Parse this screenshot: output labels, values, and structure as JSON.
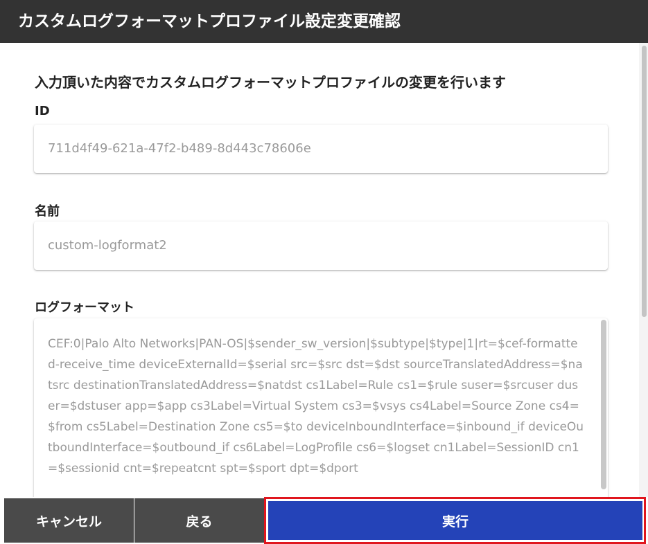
{
  "dialog": {
    "title": "カスタムログフォーマットプロファイル設定変更確認",
    "lead": "入力頂いた内容でカスタムログフォーマットプロファイルの変更を行います"
  },
  "fields": {
    "id": {
      "label": "ID",
      "value": "711d4f49-621a-47f2-b489-8d443c78606e"
    },
    "name": {
      "label": "名前",
      "value": "custom-logformat2"
    },
    "log_format": {
      "label": "ログフォーマット",
      "value": "CEF:0|Palo Alto Networks|PAN-OS|$sender_sw_version|$subtype|$type|1|rt=$cef-formatted-receive_time deviceExternalId=$serial src=$src dst=$dst sourceTranslatedAddress=$natsrc destinationTranslatedAddress=$natdst cs1Label=Rule cs1=$rule suser=$srcuser duser=$dstuser app=$app cs3Label=Virtual System cs3=$vsys cs4Label=Source Zone cs4=$from cs5Label=Destination Zone cs5=$to deviceInboundInterface=$inbound_if deviceOutboundInterface=$outbound_if cs6Label=LogProfile cs6=$logset cn1Label=SessionID cn1=$sessionid cnt=$repeatcnt spt=$sport dpt=$dport"
    }
  },
  "buttons": {
    "cancel": "キャンセル",
    "back": "戻る",
    "execute": "実行"
  },
  "colors": {
    "title_bar": "#333333",
    "secondary_button": "#4a4a4a",
    "primary_button": "#2443b8",
    "highlight_border": "#e0161e"
  }
}
